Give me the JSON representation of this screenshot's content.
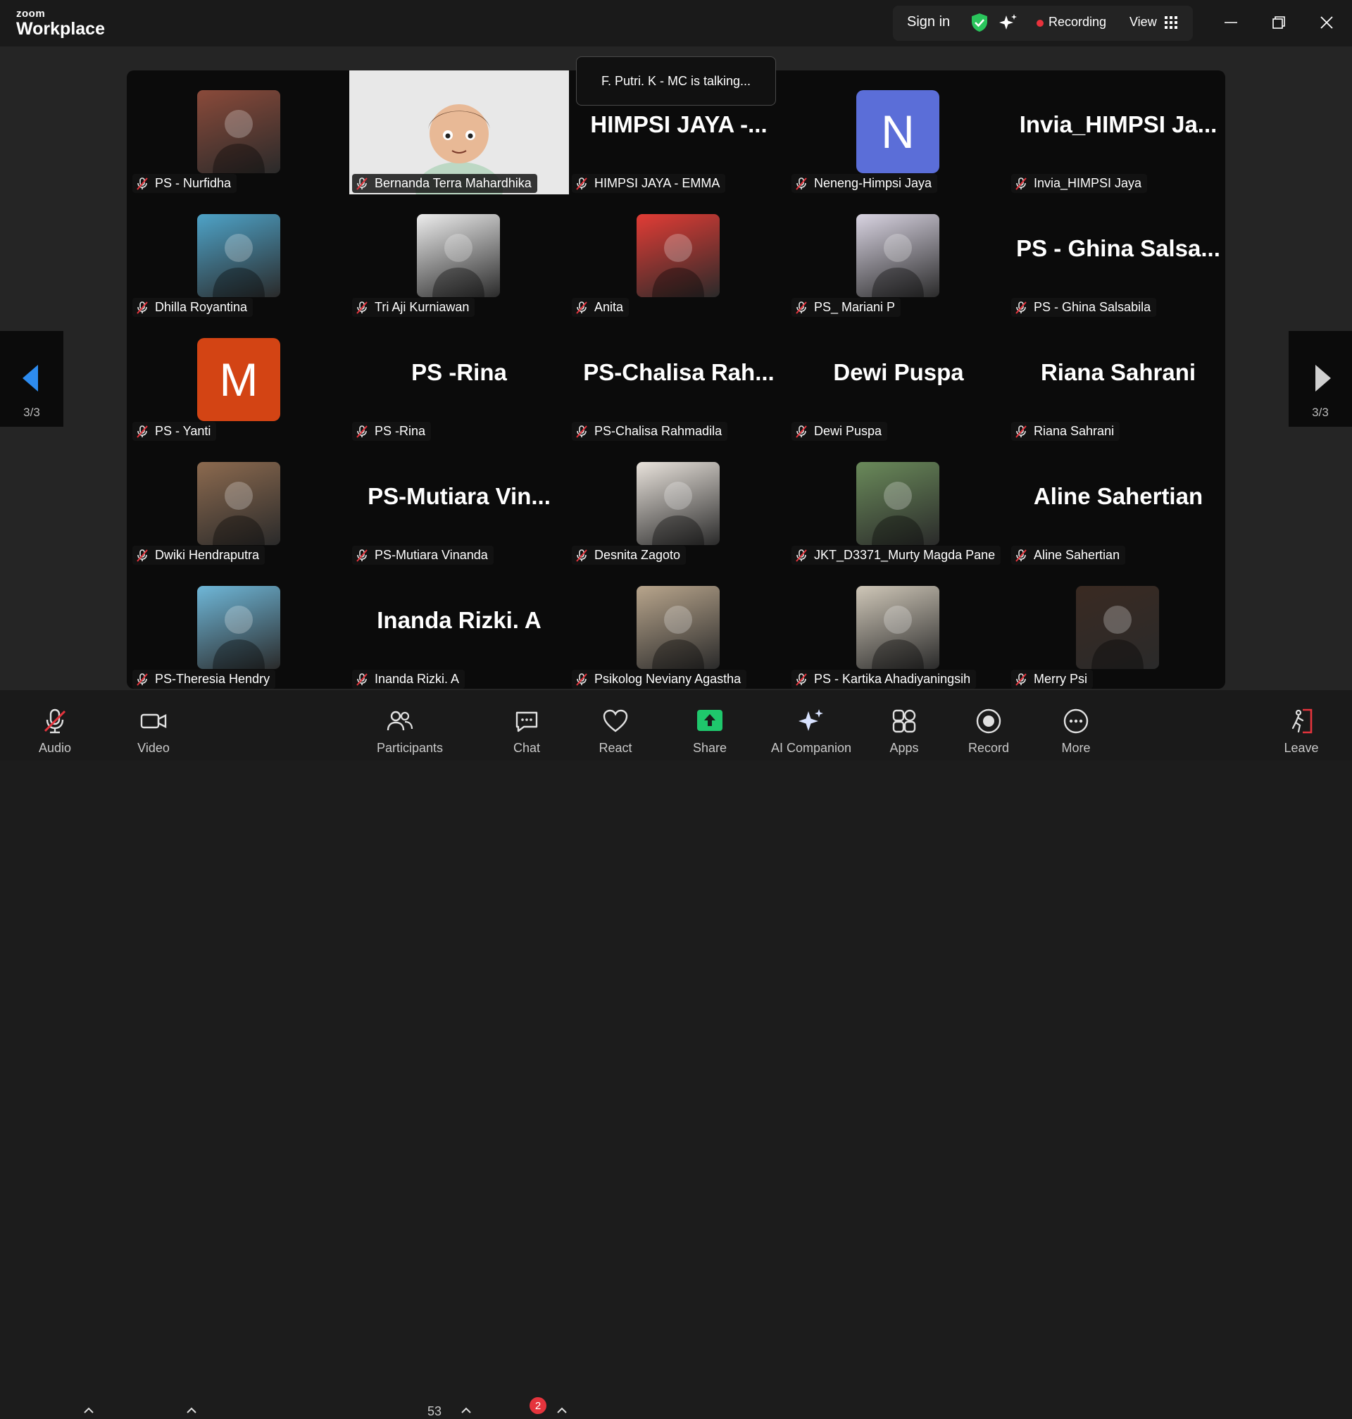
{
  "app": {
    "brand_small": "zoom",
    "brand_big": "Workplace"
  },
  "topbar": {
    "sign_in": "Sign in",
    "recording": "Recording",
    "view": "View"
  },
  "tooltip": "F. Putri. K - MC is talking...",
  "page_indicator": "3/3",
  "participants": [
    {
      "name": "PS - Nurfidha",
      "display": "photo",
      "color": "#8a4a3a"
    },
    {
      "name": "Bernanda Terra Mahardhika",
      "display": "avatar",
      "color": "#e8e8e8"
    },
    {
      "name": "HIMPSI JAYA - EMMA",
      "display": "text",
      "big": "HIMPSI JAYA -..."
    },
    {
      "name": "Neneng-Himpsi Jaya",
      "display": "letter",
      "letter": "N",
      "color": "#5b6ed8"
    },
    {
      "name": "Invia_HIMPSI Jaya",
      "display": "text",
      "big": "Invia_HIMPSI Ja..."
    },
    {
      "name": "Dhilla Royantina",
      "display": "photo",
      "color": "#4ea3c8"
    },
    {
      "name": "Tri Aji Kurniawan",
      "display": "photo",
      "color": "#ededed"
    },
    {
      "name": "Anita",
      "display": "photo",
      "color": "#e23c35"
    },
    {
      "name": "PS_ Mariani P",
      "display": "photo",
      "color": "#d9d4e2"
    },
    {
      "name": "PS - Ghina Salsabila",
      "display": "text",
      "big": "PS - Ghina Salsa..."
    },
    {
      "name": "PS - Yanti",
      "display": "letter",
      "letter": "M",
      "color": "#d34414"
    },
    {
      "name": "PS -Rina",
      "display": "text",
      "big": "PS -Rina"
    },
    {
      "name": "PS-Chalisa Rahmadila",
      "display": "text",
      "big": "PS-Chalisa Rah..."
    },
    {
      "name": "Dewi Puspa",
      "display": "text",
      "big": "Dewi Puspa"
    },
    {
      "name": "Riana Sahrani",
      "display": "text",
      "big": "Riana Sahrani"
    },
    {
      "name": "Dwiki Hendraputra",
      "display": "photo",
      "color": "#8c6a4f"
    },
    {
      "name": "PS-Mutiara Vinanda",
      "display": "text",
      "big": "PS-Mutiara Vin..."
    },
    {
      "name": "Desnita Zagoto",
      "display": "photo",
      "color": "#e9e3dc"
    },
    {
      "name": "JKT_D3371_Murty Magda Pane",
      "display": "photo",
      "color": "#6a8a5a"
    },
    {
      "name": "Aline Sahertian",
      "display": "text",
      "big": "Aline Sahertian"
    },
    {
      "name": "PS-Theresia Hendry",
      "display": "photo",
      "color": "#6fb7d8"
    },
    {
      "name": "Inanda Rizki. A",
      "display": "text",
      "big": "Inanda Rizki. A"
    },
    {
      "name": "Psikolog Neviany Agastha",
      "display": "photo",
      "color": "#b8a58c"
    },
    {
      "name": "PS - Kartika Ahadiyaningsih",
      "display": "photo",
      "color": "#cfc7b8"
    },
    {
      "name": "Merry Psi",
      "display": "photo",
      "color": "#3a2a22"
    }
  ],
  "toolbar": {
    "audio": "Audio",
    "video": "Video",
    "participants": "Participants",
    "participants_count": "53",
    "chat": "Chat",
    "chat_badge": "2",
    "react": "React",
    "share": "Share",
    "ai_companion": "AI Companion",
    "apps": "Apps",
    "record": "Record",
    "more": "More",
    "leave": "Leave"
  },
  "icons": [
    "mic-off-icon",
    "video-icon",
    "participants-icon",
    "chat-icon",
    "heart-icon",
    "share-icon",
    "sparkle-icon",
    "apps-icon",
    "record-icon",
    "more-icon",
    "leave-icon",
    "shield-icon",
    "grid-icon"
  ],
  "colors": {
    "share_green": "#1fc76c",
    "recording_red": "#e8323c",
    "nav_blue": "#2d8cf0"
  }
}
